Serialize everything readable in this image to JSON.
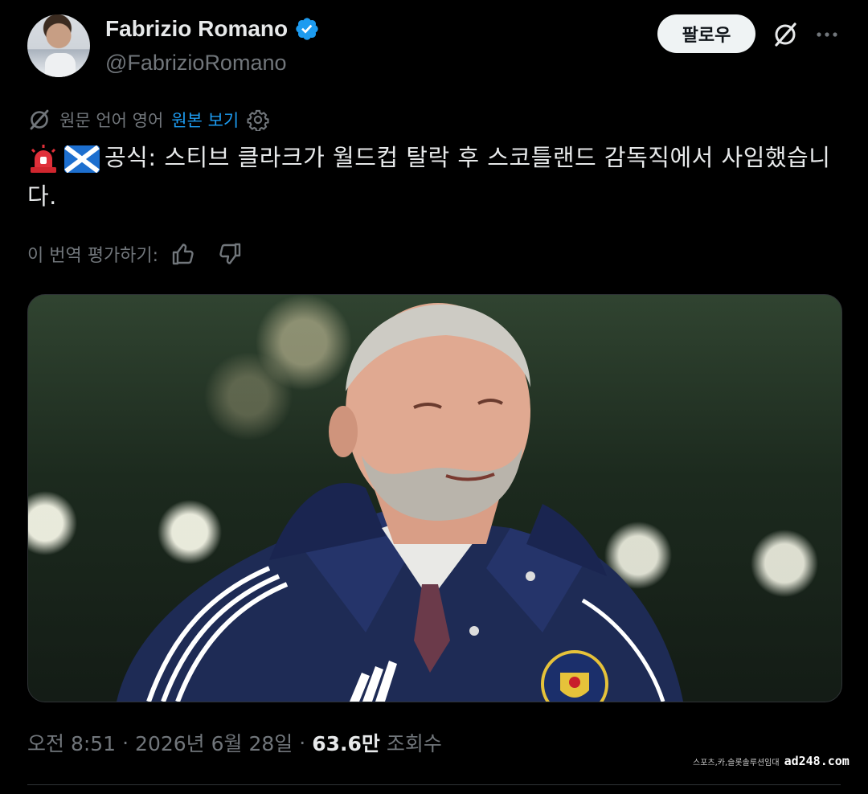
{
  "author": {
    "name": "Fabrizio Romano",
    "handle": "@FabrizioRomano",
    "verified": true,
    "avatar_icon": "avatar"
  },
  "actions": {
    "follow_label": "팔로우",
    "grok_icon": "grok-icon",
    "more_icon": "more-icon"
  },
  "translation": {
    "source_lang": "원문 언어 영어",
    "show_original": "원본 보기",
    "rate_label": "이 번역 평가하기:"
  },
  "tweet": {
    "text": "공식: 스티브 클라크가 월드컵 탈락 후 스코틀랜드 감독직에서 사임했습니다.",
    "emojis": [
      "rotating-light",
      "scotland-flag"
    ]
  },
  "meta": {
    "time": "오전 8:51",
    "separator": "·",
    "date": "2026년 6월 28일",
    "views_count": "63.6만",
    "views_label": "조회수"
  },
  "watermark": {
    "small": "스포츠,카,슬롯솔루션임대",
    "main": "ad248.com"
  },
  "colors": {
    "background": "#000000",
    "accent": "#1d9bf0",
    "text_primary": "#e7e9ea",
    "text_secondary": "#71767b"
  }
}
